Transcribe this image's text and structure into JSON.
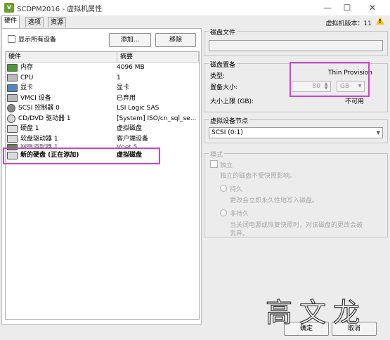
{
  "window": {
    "title": "SCDPM2016 - 虚拟机属性",
    "vm_version_label": "虚拟机版本：11"
  },
  "tabs": [
    {
      "label": "硬件"
    },
    {
      "label": "选项"
    },
    {
      "label": "资源"
    }
  ],
  "left": {
    "show_all_label": "显示所有设备",
    "add_button": "添加...",
    "remove_button": "移除",
    "columns": [
      "硬件",
      "摘要"
    ],
    "rows": [
      {
        "name": "内存",
        "summary": "4096 MB"
      },
      {
        "name": "CPU",
        "summary": "1"
      },
      {
        "name": "显卡",
        "summary": "显卡"
      },
      {
        "name": "VMCI 设备",
        "summary": "已弃用"
      },
      {
        "name": "SCSI 控制器 0",
        "summary": "LSI Logic SAS"
      },
      {
        "name": "CD/DVD 驱动器 1",
        "summary": "[System] ISO/cn_sql_se..."
      },
      {
        "name": "硬盘 1",
        "summary": "虚拟磁盘"
      },
      {
        "name": "软盘驱动器 1",
        "summary": "客户端设备"
      },
      {
        "name": "网络适配器 1",
        "summary": "Vnet 5"
      },
      {
        "name": "新的硬盘 (正在添加)",
        "summary": "虚拟磁盘"
      }
    ]
  },
  "right": {
    "disk_file_title": "磁盘文件",
    "disk_provision_title": "磁盘置备",
    "type_label": "类型:",
    "type_value": "Thin Provision",
    "size_label": "置备大小:",
    "size_value": "80",
    "size_unit": "GB",
    "max_label": "大小上限 (GB):",
    "max_value": "不可用",
    "vdn_title": "虚拟设备节点",
    "vdn_value": "SCSI (0:1)",
    "mode_title": "模式",
    "independent_label": "独立",
    "independent_desc": "独立的磁盘不受快照影响。",
    "persistent_label": "持久",
    "persistent_desc": "更改会立即永久性地写入磁盘。",
    "nonpersistent_label": "非持久",
    "nonpersistent_desc_1": "当关闭电源或恢复快照时，对该磁盘的更改会被",
    "nonpersistent_desc_2": "丢弃。"
  },
  "footer": {
    "ok": "确定",
    "cancel": "取消"
  },
  "watermark": "高文龙",
  "colors": {
    "highlight": "#d23fd2",
    "warning": "#f2c200"
  }
}
